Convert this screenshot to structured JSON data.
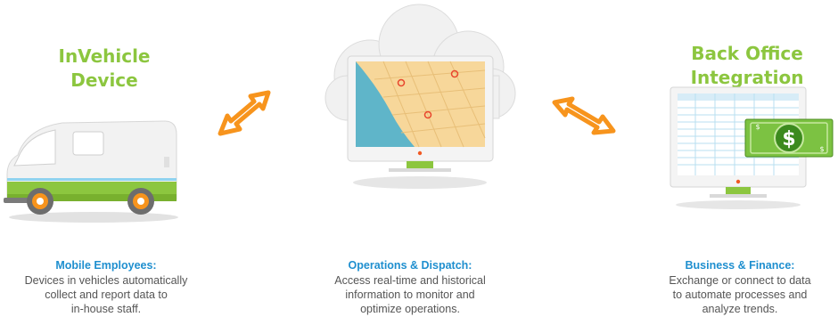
{
  "left": {
    "title_lines": [
      "InVehicle",
      "Device"
    ],
    "caption": {
      "heading": "Mobile Employees:",
      "lines": [
        "Devices in vehicles automatically",
        "collect and report data to",
        "in-house staff."
      ]
    }
  },
  "middle": {
    "caption": {
      "heading": "Operations & Dispatch:",
      "lines": [
        "Access real-time and historical",
        "information to monitor and",
        "optimize operations."
      ]
    }
  },
  "right": {
    "title_lines": [
      "Back Office",
      "Integration"
    ],
    "caption": {
      "heading": "Business & Finance:",
      "lines": [
        "Exchange or connect to data",
        "to automate processes and",
        "analyze trends."
      ]
    },
    "money_symbols": [
      "$",
      "$",
      "$"
    ]
  },
  "colors": {
    "title_green": "#8cc63f",
    "heading_blue": "#1f8fcf",
    "arrow_orange": "#f7941d",
    "body_gray": "#555555"
  },
  "icons": [
    "van-illustration",
    "double-arrow-icon",
    "cloud-monitor-map-illustration",
    "spreadsheet-monitor-money-illustration"
  ]
}
